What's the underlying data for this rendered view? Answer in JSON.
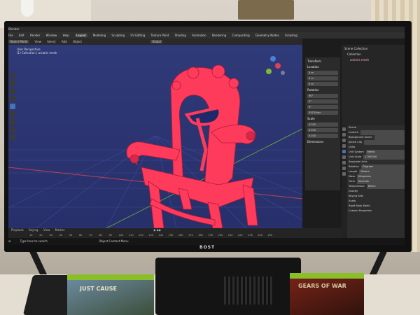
{
  "app": {
    "window_title": "Blender",
    "menus": [
      "File",
      "Edit",
      "Render",
      "Window",
      "Help"
    ],
    "workspaces": [
      "Layout",
      "Modeling",
      "Sculpting",
      "UV Editing",
      "Texture Paint",
      "Shading",
      "Animation",
      "Rendering",
      "Compositing",
      "Geometry Nodes",
      "Scripting"
    ],
    "mode": "Object Mode",
    "header_items": [
      "View",
      "Select",
      "Add",
      "Object"
    ],
    "transform_orientation": "Global",
    "viewport_label_1": "User Perspective",
    "viewport_label_2": "(1) Collection | arclaris mesh"
  },
  "n_panel": {
    "title": "Transform",
    "location_label": "Location",
    "rotation_label": "Rotation",
    "rotation_mode": "XYZ Euler",
    "scale_label": "Scale",
    "dimensions_label": "Dimensions",
    "location": [
      "0 m",
      "0 m",
      "0 m"
    ],
    "rotation": [
      "90°",
      "0°",
      "0°"
    ],
    "scale": [
      "0.010",
      "0.010",
      "0.010"
    ]
  },
  "outliner": {
    "items": [
      "Scene Collection",
      "Collection",
      "arclaris mesh"
    ]
  },
  "properties": {
    "scene_label": "Scene",
    "camera_label": "Camera",
    "background_scene_label": "Background Scene",
    "active_clip_label": "Active Clip",
    "units_label": "Units",
    "unit_system_label": "Unit System",
    "unit_system_value": "Metric",
    "unit_scale_label": "Unit Scale",
    "unit_scale_value": "1.000000",
    "separate_units_label": "Separate Units",
    "rotation_label": "Rotation",
    "rotation_value": "Degrees",
    "length_label": "Length",
    "length_value": "Meters",
    "mass_label": "Mass",
    "mass_value": "Kilograms",
    "time_label": "Time",
    "time_value": "Seconds",
    "temperature_label": "Temperature",
    "temperature_value": "Kelvin",
    "sections": [
      "Gravity",
      "Keying Sets",
      "Audio",
      "Rigid Body World",
      "Custom Properties"
    ]
  },
  "timeline": {
    "menu": [
      "Playback",
      "Keying",
      "View",
      "Marker"
    ],
    "frames": [
      "10",
      "20",
      "30",
      "40",
      "50",
      "60",
      "70",
      "80",
      "90",
      "100",
      "110",
      "120",
      "130",
      "140",
      "150",
      "160",
      "170",
      "180",
      "190",
      "200",
      "210",
      "220",
      "230",
      "240",
      "250"
    ]
  },
  "taskbar": {
    "search_placeholder": "Type here to search",
    "item": "Object Context Menu"
  },
  "monitor": {
    "brand": "BOST"
  },
  "games": {
    "left_title": "JUST CAUSE",
    "right_title": "GEARS OF WAR"
  },
  "colors": {
    "chair": "#ff3b5c",
    "viewport_bg": "#2c3573",
    "accent": "#4772b3"
  }
}
